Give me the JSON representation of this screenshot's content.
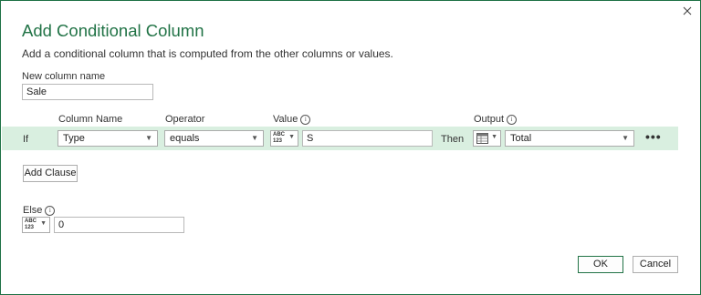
{
  "dialog": {
    "title": "Add Conditional Column",
    "subtitle": "Add a conditional column that is computed from the other columns or values.",
    "close_icon": "close-icon"
  },
  "new_column": {
    "label": "New column name",
    "value": "Sale"
  },
  "clause_headers": {
    "column_name": "Column Name",
    "operator": "Operator",
    "value": "Value",
    "output": "Output"
  },
  "clause": {
    "if_label": "If",
    "column_name": "Type",
    "operator": "equals",
    "value_type": "ABC 123",
    "value": "S",
    "then_label": "Then",
    "output_type_icon": "table-icon",
    "output": "Total",
    "more_icon": "ellipsis-icon"
  },
  "add_clause_label": "Add Clause",
  "else": {
    "label": "Else",
    "value_type": "ABC 123",
    "value": "0"
  },
  "buttons": {
    "ok": "OK",
    "cancel": "Cancel"
  },
  "colors": {
    "accent": "#217346",
    "row_band": "#d9efe0",
    "border": "#1e7145"
  }
}
